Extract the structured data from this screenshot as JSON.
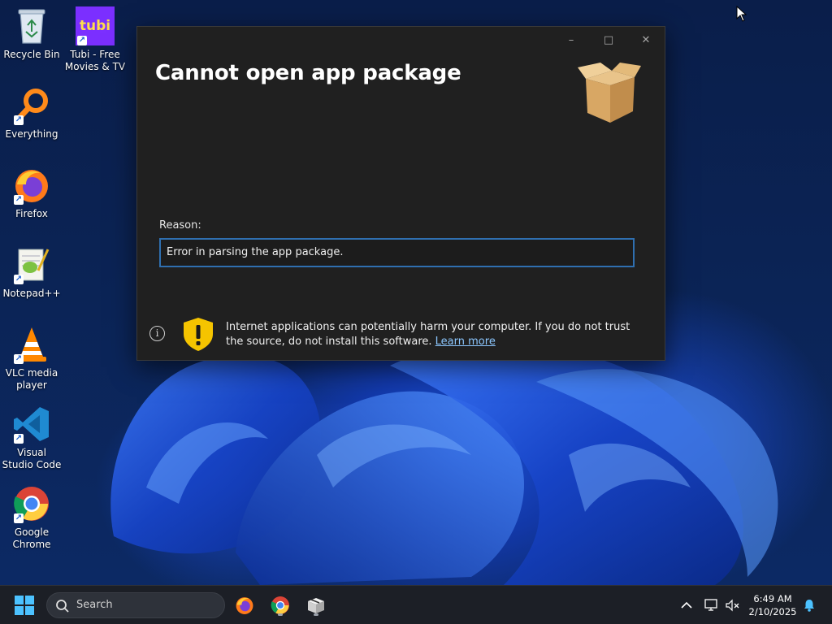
{
  "desktop": {
    "icons": [
      {
        "label": "Recycle Bin",
        "icon": "recycle-bin-icon"
      },
      {
        "label": "Tubi - Free Movies & TV",
        "icon": "tubi-icon",
        "logo_text": "tubi"
      },
      {
        "label": "Everything",
        "icon": "everything-search-icon"
      },
      {
        "label": "Firefox",
        "icon": "firefox-icon"
      },
      {
        "label": "Notepad++",
        "icon": "notepadpp-icon"
      },
      {
        "label": "VLC media player",
        "icon": "vlc-icon"
      },
      {
        "label": "Visual Studio Code",
        "icon": "vscode-icon"
      },
      {
        "label": "Google Chrome",
        "icon": "chrome-icon"
      }
    ]
  },
  "dialog": {
    "title": "Cannot open app package",
    "reason_label": "Reason:",
    "reason_value": "Error in parsing the app package.",
    "warning_text": "Internet applications can potentially harm your computer. If you do not trust the source, do not install this software.",
    "learn_more": "Learn more",
    "controls": {
      "minimize": "–",
      "maximize": "□",
      "close": "✕"
    },
    "info_glyph": "i"
  },
  "taskbar": {
    "search_label": "Search",
    "time": "6:49 AM",
    "date": "2/10/2025",
    "pinned": [
      "firefox-icon",
      "chrome-icon",
      "app-installer-icon"
    ]
  },
  "colors": {
    "dialog_bg": "#202020",
    "field_border": "#2f6fb0",
    "link": "#8cc7ff",
    "taskbar_bg": "#1c1f26"
  }
}
